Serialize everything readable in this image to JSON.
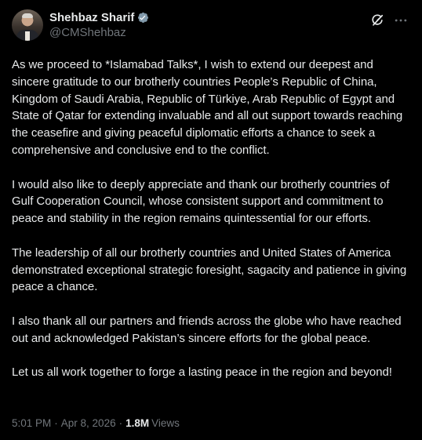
{
  "author": {
    "display_name": "Shehbaz Sharif",
    "handle": "@CMShehbaz",
    "verified": true
  },
  "icons": {
    "verified": "verified-badge-icon",
    "grok": "grok-icon",
    "more": "more-options-icon"
  },
  "colors": {
    "background": "#000000",
    "text": "#e7e9ea",
    "secondary_text": "#71767b",
    "verified_badge": "#829aab"
  },
  "tweet": {
    "paragraphs": [
      "As we proceed to *Islamabad Talks*, I wish to extend our deepest and sincere gratitude to our brotherly countries People’s Republic of China, Kingdom of Saudi Arabia, Republic of Türkiye, Arab Republic of Egypt and State of Qatar for extending invaluable and all out support towards reaching the ceasefire and giving peaceful diplomatic efforts a chance to seek a comprehensive and conclusive end to the conflict.",
      "I would also like to deeply appreciate and thank our brotherly countries of Gulf Cooperation Council, whose consistent support and commitment to peace and stability in the region remains quintessential for our efforts.",
      "The leadership of all our brotherly countries and United States of America demonstrated exceptional strategic foresight, sagacity and patience in giving peace a chance.",
      "I also thank all our partners and friends across the globe who have reached out and acknowledged Pakistan’s sincere efforts for the global peace.",
      "Let us all work together to forge a lasting peace in the region and beyond!"
    ],
    "time": "5:01 PM",
    "separator": "·",
    "date": "Apr 8, 2026",
    "views_count": "1.8M",
    "views_label": "Views"
  }
}
